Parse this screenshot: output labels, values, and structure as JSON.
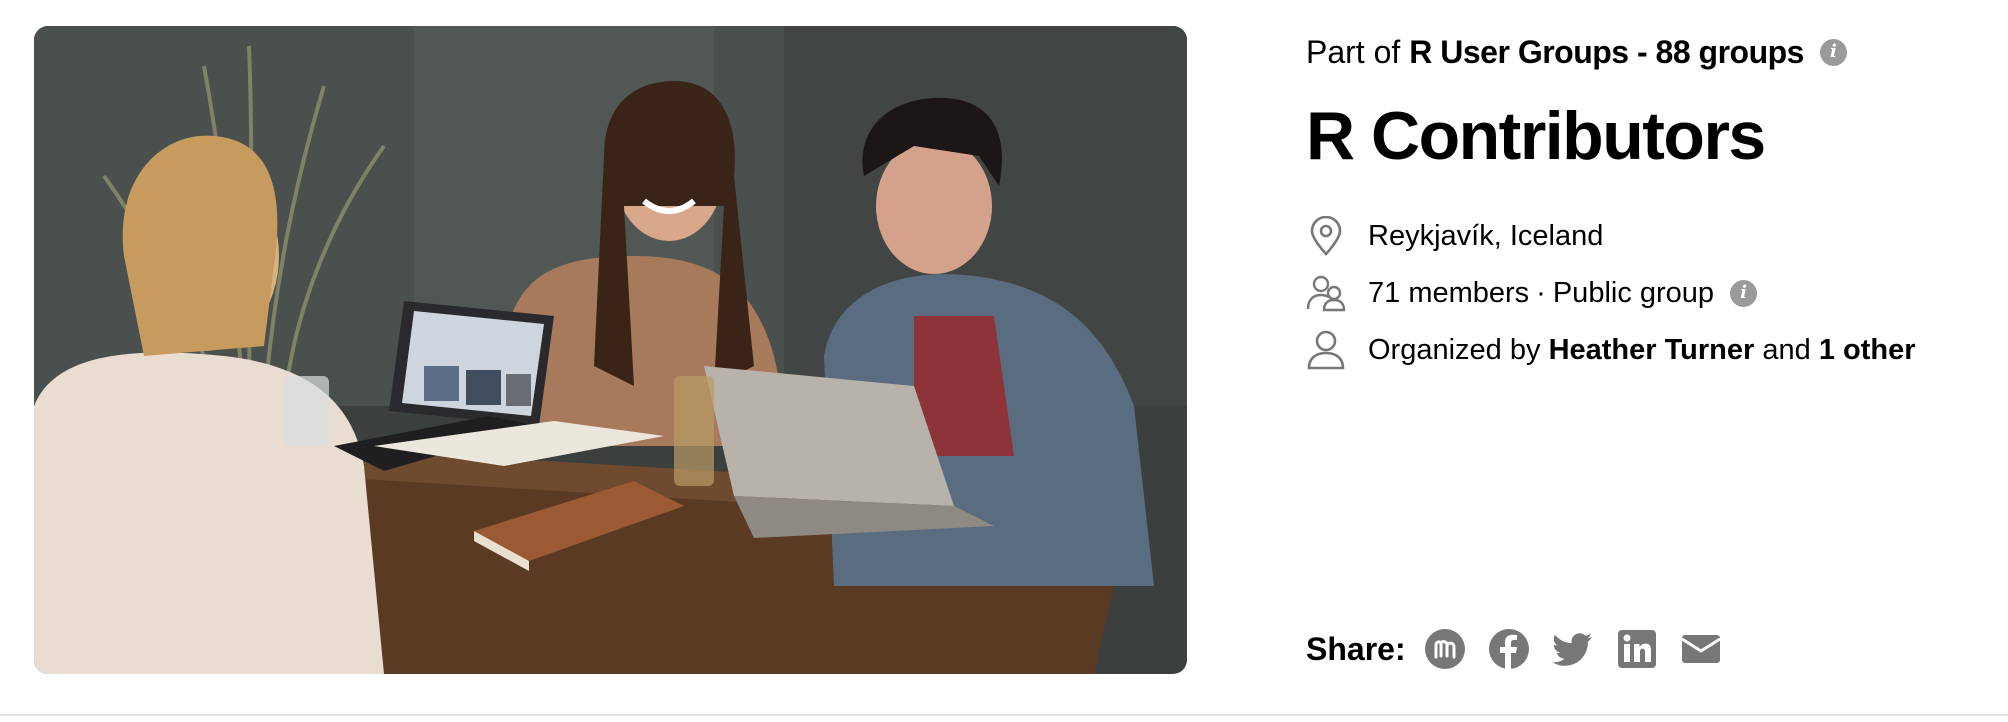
{
  "group": {
    "part_of_prefix": "Part of",
    "network_name": "R User Groups - 88 groups",
    "title": "R Contributors",
    "location": "Reykjavík, Iceland",
    "members": "71 members",
    "separator": "·",
    "visibility": "Public group",
    "organized_prefix": "Organized by",
    "organizer": "Heather Turner",
    "organized_and": "and",
    "organized_others": "1 other"
  },
  "share": {
    "label": "Share:",
    "buttons": [
      {
        "icon": "meetup-icon"
      },
      {
        "icon": "facebook-icon"
      },
      {
        "icon": "twitter-icon"
      },
      {
        "icon": "linkedin-icon"
      },
      {
        "icon": "email-icon"
      }
    ]
  },
  "colors": {
    "icon_gray": "#777777",
    "info_gray": "#9a9a9a",
    "divider": "#e3e3e3"
  }
}
